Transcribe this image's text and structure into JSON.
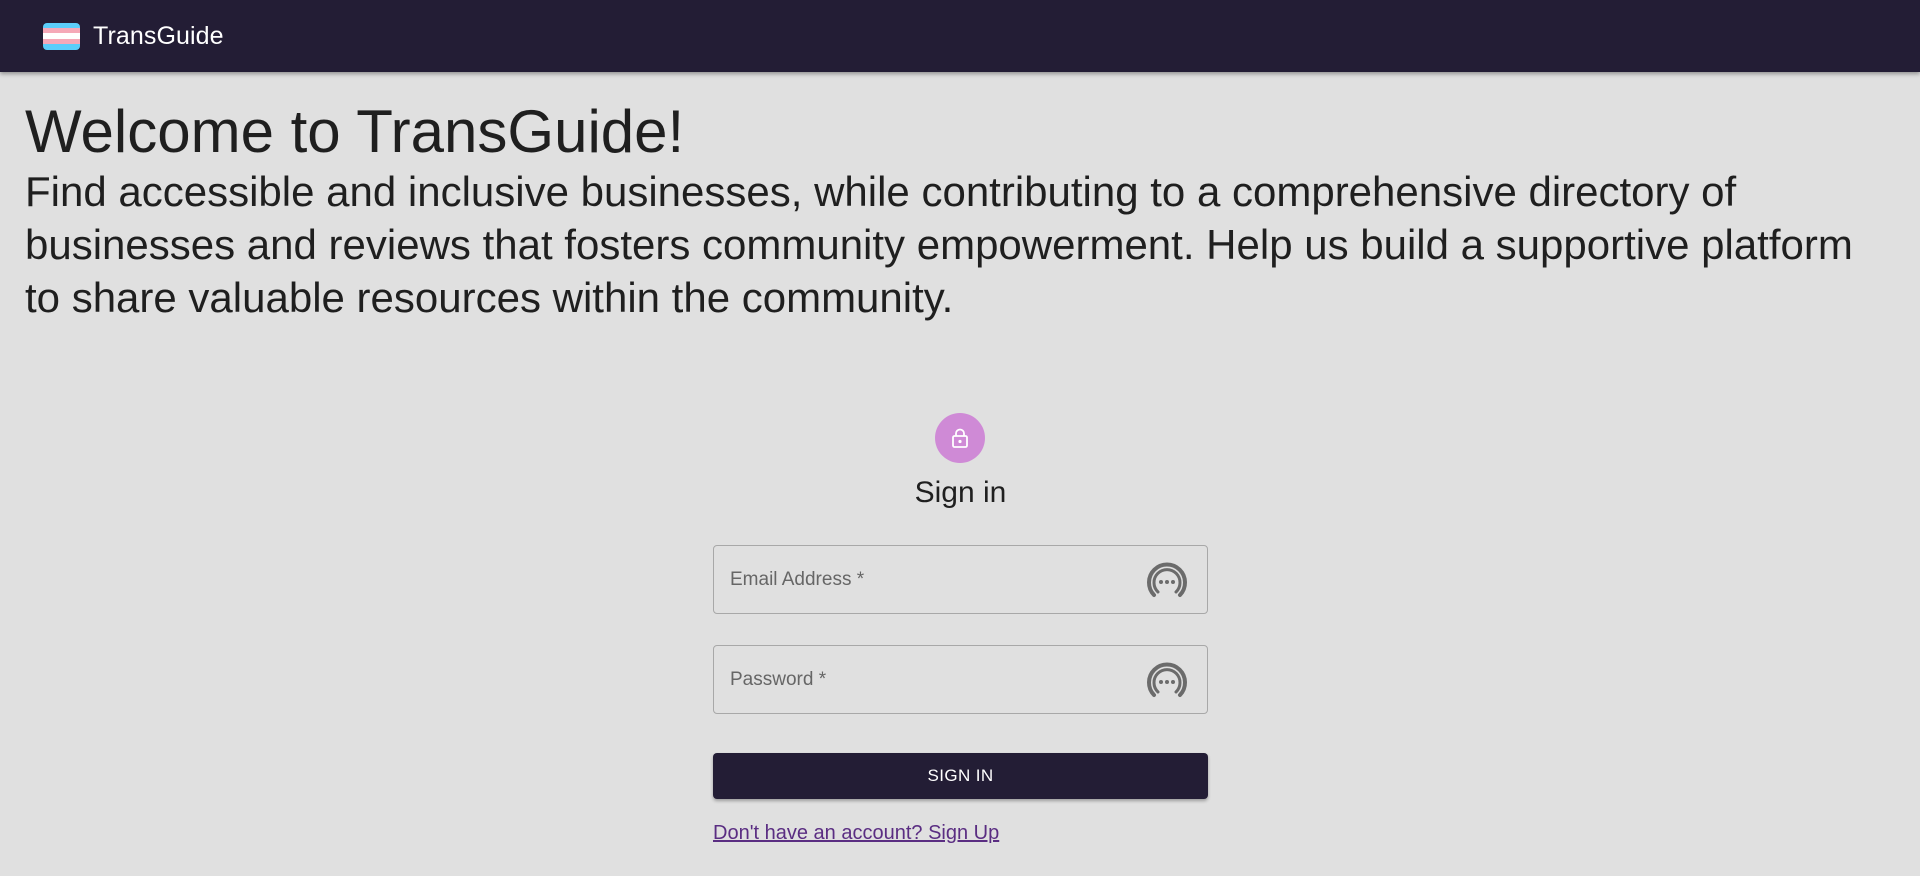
{
  "header": {
    "brand": "TransGuide",
    "logo_icon": "trans-flag-icon",
    "background": "#231d35",
    "flag_colors": [
      "#5bcefa",
      "#f5a9b8",
      "#ffffff",
      "#f5a9b8",
      "#5bcefa"
    ]
  },
  "hero": {
    "title": "Welcome to TransGuide!",
    "description": "Find accessible and inclusive businesses, while contributing to a comprehensive directory of businesses and reviews that fosters community empowerment. Help us build a supportive platform to share valuable resources within the community."
  },
  "signin": {
    "avatar_icon": "lock-icon",
    "avatar_color": "#cf8ad6",
    "title": "Sign in",
    "email_placeholder": "Email Address *",
    "password_placeholder": "Password *",
    "field_icon": "password-manager-icon",
    "button_label": "SIGN IN",
    "signup_link": "Don't have an account? Sign Up"
  }
}
